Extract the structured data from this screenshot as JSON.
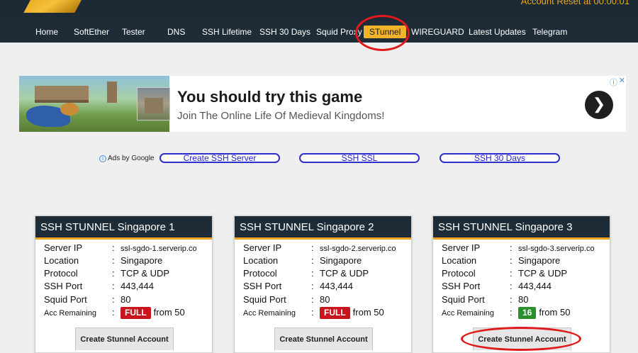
{
  "header": {
    "reset_text": "Account Reset at 00:00:01"
  },
  "nav": [
    {
      "label": "Home"
    },
    {
      "label": "SoftEther"
    },
    {
      "label": "Tester"
    },
    {
      "label": "DNS"
    },
    {
      "label": "SSH Lifetime"
    },
    {
      "label": "SSH 30 Days"
    },
    {
      "label": "Squid Proxy"
    },
    {
      "label": "STunnel"
    },
    {
      "label": "WIREGUARD"
    },
    {
      "label": "Latest Updates"
    },
    {
      "label": "Telegram"
    }
  ],
  "ad": {
    "headline": "You should try this game",
    "subline": "Join The Online Life Of Medieval Kingdoms!",
    "next_glyph": "❯",
    "info_glyph": "ⓘ",
    "close_glyph": "✕"
  },
  "ads_by": {
    "label": "Ads by Google"
  },
  "ad_links": [
    "Create SSH Server",
    "SSH SSL",
    "SSH 30 Days"
  ],
  "labels": {
    "server_ip": "Server IP",
    "location": "Location",
    "protocol": "Protocol",
    "ssh_port": "SSH Port",
    "squid_port": "Squid Port",
    "acc_remaining": "Acc Remaining",
    "colon": ":",
    "from": "from 50"
  },
  "servers": [
    {
      "title": "SSH STUNNEL Singapore 1",
      "server_ip": "ssl-sgdo-1.serverip.co",
      "location": "Singapore",
      "protocol": "TCP & UDP",
      "ssh_port": "443,444",
      "squid_port": "80",
      "remaining": "FULL",
      "button": "Create Stunnel Account"
    },
    {
      "title": "SSH STUNNEL Singapore 2",
      "server_ip": "ssl-sgdo-2.serverip.co",
      "location": "Singapore",
      "protocol": "TCP & UDP",
      "ssh_port": "443,444",
      "squid_port": "80",
      "remaining": "FULL",
      "button": "Create Stunnel Account"
    },
    {
      "title": "SSH STUNNEL Singapore 3",
      "server_ip": "ssl-sgdo-3.serverip.co",
      "location": "Singapore",
      "protocol": "TCP & UDP",
      "ssh_port": "443,444",
      "squid_port": "80",
      "remaining": "16",
      "button": "Create Stunnel Account"
    }
  ],
  "colors": {
    "nav_bg": "#1d2c37",
    "accent": "#f1b32b",
    "badge_full": "#c9161d",
    "badge_ok": "#2a8f2d",
    "annotation": "#e01919"
  }
}
